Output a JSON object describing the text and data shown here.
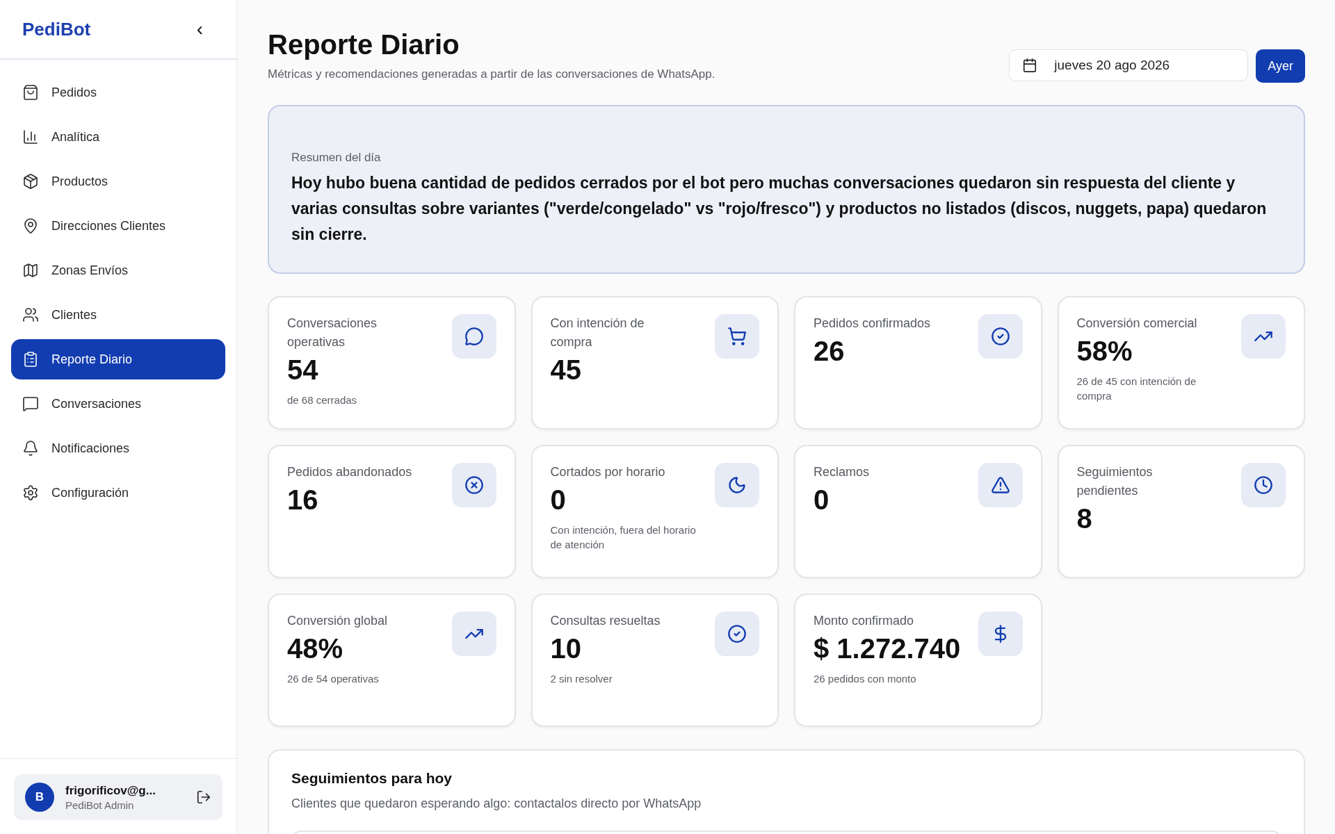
{
  "sidebar": {
    "brand": "PediBot",
    "collapse": "‹",
    "items": [
      {
        "label": "Pedidos",
        "selected": false
      },
      {
        "label": "Analítica",
        "selected": false
      },
      {
        "label": "Productos",
        "selected": false
      },
      {
        "label": "Direcciones Clientes",
        "selected": false
      },
      {
        "label": "Zonas Envíos",
        "selected": false
      },
      {
        "label": "Clientes",
        "selected": false
      },
      {
        "label": "Reporte Diario",
        "selected": true
      },
      {
        "label": "Conversaciones",
        "selected": false
      },
      {
        "label": "Notificaciones",
        "selected": false
      },
      {
        "label": "Configuración",
        "selected": false
      }
    ],
    "user": {
      "initial": "B",
      "email": "frigorificov@g...",
      "role": "PediBot Admin"
    }
  },
  "header": {
    "title": "Reporte Diario",
    "subtitle": "Métricas y recomendaciones generadas a partir de las conversaciones de WhatsApp.",
    "date": "jueves 20 ago 2026",
    "button": "Ayer"
  },
  "summary": {
    "label": "Resumen del día",
    "text": "Hoy hubo buena cantidad de pedidos cerrados por el bot pero muchas conversaciones quedaron sin respuesta del cliente y varias consultas sobre variantes (\"verde/congelado\" vs \"rojo/fresco\") y productos no listados (discos, nuggets, papa) quedaron sin cierre."
  },
  "metrics": [
    {
      "label": "Conversaciones operativas",
      "value": "54",
      "note": "de 68 cerradas"
    },
    {
      "label": "Con intención de compra",
      "value": "45"
    },
    {
      "label": "Pedidos confirmados",
      "value": "26"
    },
    {
      "label": "Conversión comercial",
      "value": "58%",
      "note": "26 de 45 con intención de compra"
    },
    {
      "label": "Pedidos abandonados",
      "value": "16"
    },
    {
      "label": "Cortados por horario",
      "value": "0",
      "note": "Con intención, fuera del horario de atención"
    },
    {
      "label": "Reclamos",
      "value": "0"
    },
    {
      "label": "Seguimientos pendientes",
      "value": "8"
    },
    {
      "label": "Conversión global",
      "value": "48%",
      "note": "26 de 54 operativas"
    },
    {
      "label": "Consultas resueltas",
      "value": "10",
      "note": "2 sin resolver"
    },
    {
      "label": "Monto confirmado",
      "value": "$ 1.272.740",
      "note": "26 pedidos con monto"
    }
  ],
  "followups": {
    "title": "Seguimientos para hoy",
    "subtitle": "Clientes que quedaron esperando algo: contactalos directo por WhatsApp"
  }
}
